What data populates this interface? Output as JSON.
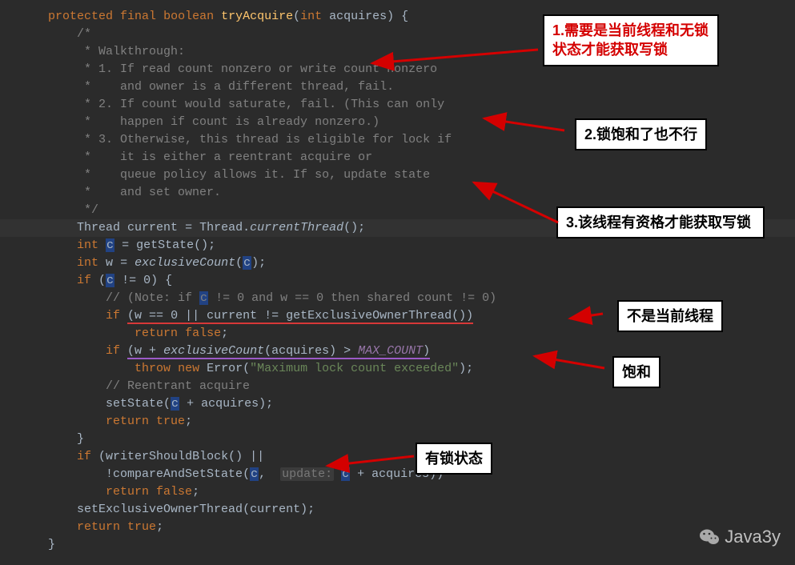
{
  "code": {
    "sig_protected": "protected",
    "sig_final": "final",
    "sig_boolean": "boolean",
    "sig_name": "tryAcquire",
    "sig_int": "int",
    "sig_param": "acquires",
    "c_open": "/*",
    "c_walk": " * Walkthrough:",
    "c_1": " * 1. If read count nonzero or write count nonzero",
    "c_1b": " *    and owner is a different thread, fail.",
    "c_2": " * 2. If count would saturate, fail. (This can only",
    "c_2b": " *    happen if count is already nonzero.)",
    "c_3": " * 3. Otherwise, this thread is eligible for lock if",
    "c_3b": " *    it is either a reentrant acquire or",
    "c_3c": " *    queue policy allows it. If so, update state",
    "c_3d": " *    and set owner.",
    "c_close": " */",
    "thread_type": "Thread",
    "current": "current",
    "eq": " = ",
    "thread_static": "Thread.",
    "current_thread": "currentThread",
    "empty_call": "();",
    "int_kw": "int",
    "c_var": "c",
    "getstate": "getState",
    "w_var": "w",
    "excl_count": "exclusiveCount",
    "open_c": "(",
    "close_c": ");",
    "if_kw": "if",
    "neq_zero": " != ",
    "zero": "0",
    "brace_open": ") {",
    "note": "// (Note: if ",
    "note2": " != 0 and w == 0 then shared count != 0)",
    "cond1_a": "(w == ",
    "cond1_b": " || current != ",
    "get_owner": "getExclusiveOwnerThread",
    "cond1_c": "())",
    "return_kw": "return",
    "false_kw": "false",
    "semi": ";",
    "cond2_a": "(w + ",
    "cond2_b": "(acquires) > ",
    "max_count": "MAX_COUNT",
    "cond2_c": ")",
    "throw_kw": "throw",
    "new_kw": "new",
    "error_cls": "Error",
    "err_msg": "\"Maximum lock count exceeded\"",
    "err_end": ");",
    "reentrant": "// Reentrant acquire",
    "setstate": "setState",
    "plus_acq": " + acquires);",
    "true_kw": "true",
    "brace_close": "}",
    "wsb": "writerShouldBlock",
    "or": "() ||",
    "cass": "compareAndSetState",
    "cass_open": "(",
    "comma": ",  ",
    "update_hint": "update:",
    "plus_acq2": " + acquires))",
    "set_owner": "setExclusiveOwnerThread",
    "owner_arg": "(current);",
    "bang": "!"
  },
  "annotations": {
    "a1": "1.需要是当前线程和无锁状态才能获取写锁",
    "a2": "2.锁饱和了也不行",
    "a3": "3.该线程有资格才能获取写锁",
    "a4": "不是当前线程",
    "a5": "饱和",
    "a6": "有锁状态"
  },
  "watermark": "Java3y"
}
